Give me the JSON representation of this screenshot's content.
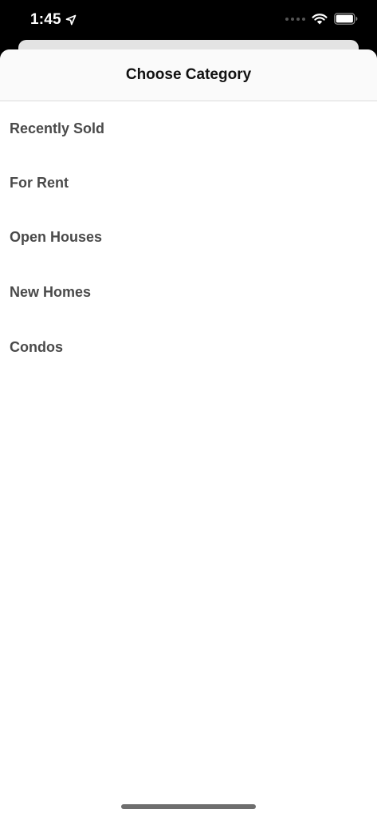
{
  "status_bar": {
    "time": "1:45",
    "icons": [
      "location-arrow-icon",
      "cellular-signal-icon",
      "wifi-icon",
      "battery-icon"
    ]
  },
  "sheet": {
    "title": "Choose Category"
  },
  "categories": [
    {
      "label": "Recently Sold"
    },
    {
      "label": "For Rent"
    },
    {
      "label": "Open Houses"
    },
    {
      "label": "New Homes"
    },
    {
      "label": "Condos"
    }
  ],
  "colors": {
    "status_bar_bg": "#000000",
    "sheet_bg": "#ffffff",
    "header_bg": "#fafafa",
    "title_text": "#111111",
    "item_text": "#4a4a4a"
  }
}
